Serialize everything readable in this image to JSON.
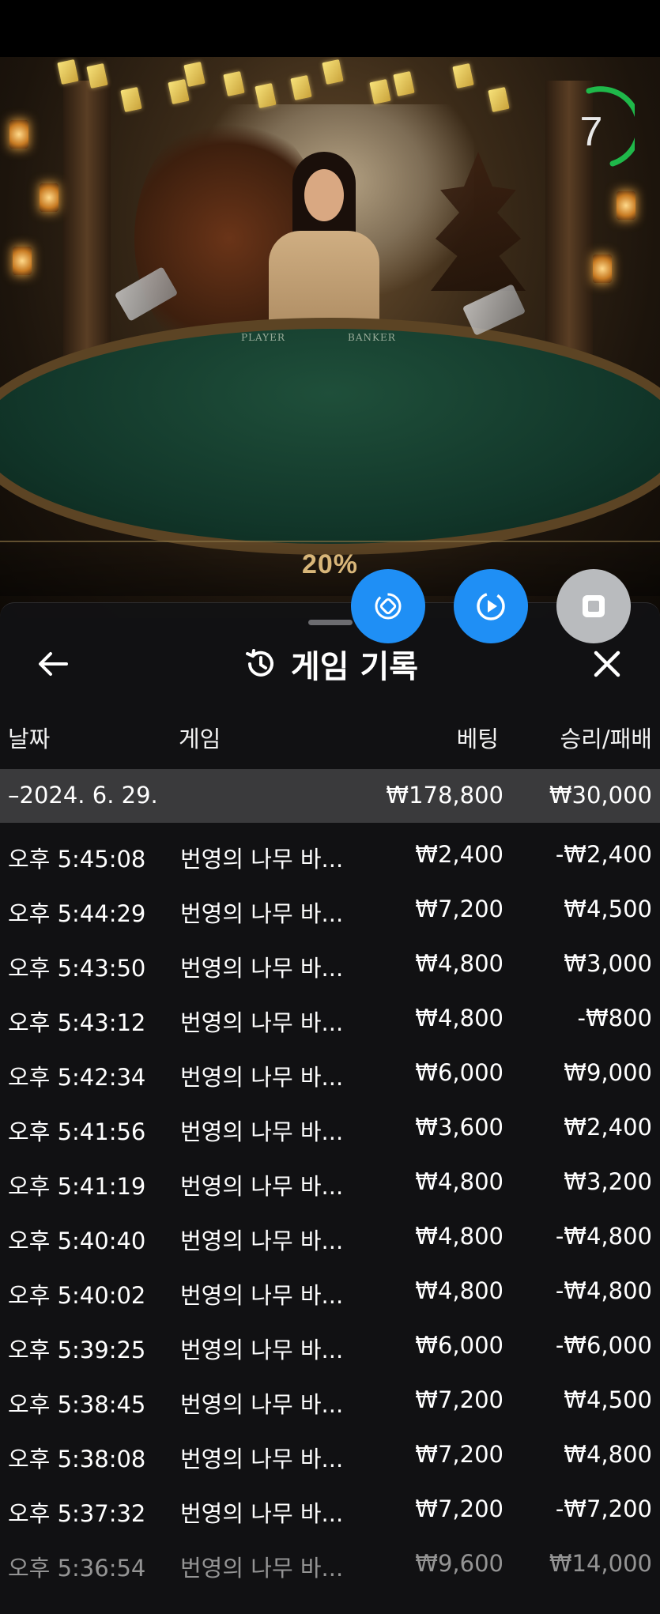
{
  "video": {
    "timer_value": "7",
    "felt_labels": [
      "PLAYER",
      "BANKER"
    ],
    "progress_label": "20%",
    "progress_value": 0.2
  },
  "controls": [
    {
      "name": "swap-view-icon",
      "color": "#1f8ff5"
    },
    {
      "name": "replay-icon",
      "color": "#1f8ff5"
    },
    {
      "name": "stop-icon",
      "color": "#b9bbbe"
    }
  ],
  "panel": {
    "title": "게임 기록",
    "columns": {
      "date": "날짜",
      "game": "게임",
      "bet": "베팅",
      "winloss": "승리/패배"
    },
    "summary": {
      "date": "–2024. 6. 29.",
      "bet": "₩178,800",
      "winloss": "₩30,000"
    },
    "rows": [
      {
        "time": "오후 5:45:08",
        "game": "번영의 나무 바...",
        "bet": "₩2,400",
        "winloss": "-₩2,400"
      },
      {
        "time": "오후 5:44:29",
        "game": "번영의 나무 바...",
        "bet": "₩7,200",
        "winloss": "₩4,500"
      },
      {
        "time": "오후 5:43:50",
        "game": "번영의 나무 바...",
        "bet": "₩4,800",
        "winloss": "₩3,000"
      },
      {
        "time": "오후 5:43:12",
        "game": "번영의 나무 바...",
        "bet": "₩4,800",
        "winloss": "-₩800"
      },
      {
        "time": "오후 5:42:34",
        "game": "번영의 나무 바...",
        "bet": "₩6,000",
        "winloss": "₩9,000"
      },
      {
        "time": "오후 5:41:56",
        "game": "번영의 나무 바...",
        "bet": "₩3,600",
        "winloss": "₩2,400"
      },
      {
        "time": "오후 5:41:19",
        "game": "번영의 나무 바...",
        "bet": "₩4,800",
        "winloss": "₩3,200"
      },
      {
        "time": "오후 5:40:40",
        "game": "번영의 나무 바...",
        "bet": "₩4,800",
        "winloss": "-₩4,800"
      },
      {
        "time": "오후 5:40:02",
        "game": "번영의 나무 바...",
        "bet": "₩4,800",
        "winloss": "-₩4,800"
      },
      {
        "time": "오후 5:39:25",
        "game": "번영의 나무 바...",
        "bet": "₩6,000",
        "winloss": "-₩6,000"
      },
      {
        "time": "오후 5:38:45",
        "game": "번영의 나무 바...",
        "bet": "₩7,200",
        "winloss": "₩4,500"
      },
      {
        "time": "오후 5:38:08",
        "game": "번영의 나무 바...",
        "bet": "₩7,200",
        "winloss": "₩4,800"
      },
      {
        "time": "오후 5:37:32",
        "game": "번영의 나무 바...",
        "bet": "₩7,200",
        "winloss": "-₩7,200"
      },
      {
        "time": "오후 5:36:54",
        "game": "번영의 나무 바...",
        "bet": "₩9,600",
        "winloss": "₩14,000"
      }
    ]
  }
}
